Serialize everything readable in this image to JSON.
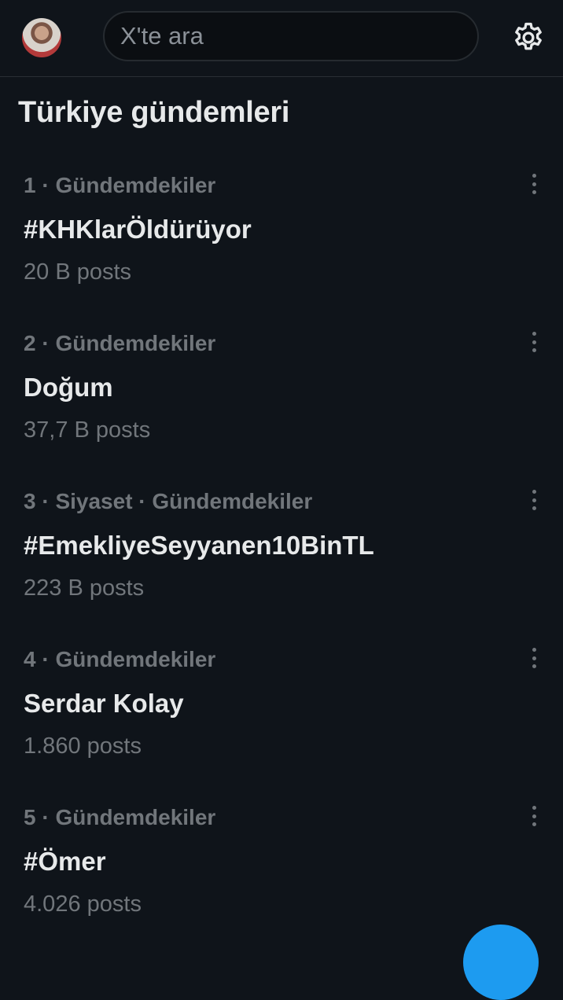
{
  "header": {
    "avatar_icon": "user-avatar",
    "search_placeholder": "X'te ara",
    "settings_icon": "gear-icon"
  },
  "page_title": "Türkiye gündemleri",
  "trends": [
    {
      "meta": "1 · Gündemdekiler",
      "name": "#KHKlarÖldürüyor",
      "count": "20 B posts"
    },
    {
      "meta": "2 · Gündemdekiler",
      "name": "Doğum",
      "count": "37,7 B posts"
    },
    {
      "meta": "3 · Siyaset · Gündemdekiler",
      "name": "#EmekliyeSeyyanen10BinTL",
      "count": "223 B posts"
    },
    {
      "meta": "4 · Gündemdekiler",
      "name": "Serdar Kolay",
      "count": "1.860 posts"
    },
    {
      "meta": "5 · Gündemdekiler",
      "name": "#Ömer",
      "count": "4.026 posts"
    }
  ],
  "colors": {
    "background": "#0f141a",
    "text_primary": "#e7e9ea",
    "text_secondary": "#71767b",
    "accent": "#1d9bf0"
  }
}
